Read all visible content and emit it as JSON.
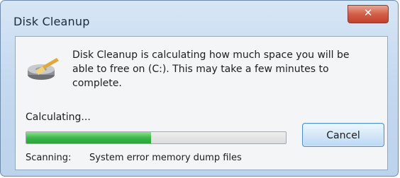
{
  "window": {
    "title": "Disk Cleanup",
    "close_icon": "close-icon"
  },
  "dialog": {
    "icon": "disk-cleanup-icon",
    "message": "Disk Cleanup is calculating how much space you will be\nable to free on  (C:). This may take a few minutes to\ncomplete.",
    "status_label": "Calculating...",
    "progress": {
      "fraction": 0.48,
      "color": "#3cb94a"
    },
    "cancel_label": "Cancel",
    "scan_label": "Scanning:",
    "scan_item": "System error memory dump files"
  }
}
